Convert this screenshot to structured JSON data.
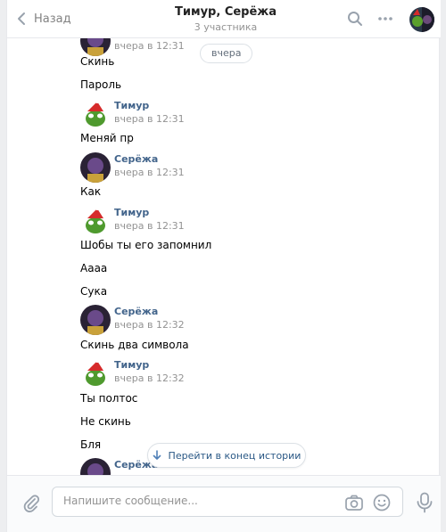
{
  "header": {
    "back_label": "Назад",
    "title": "Тимур, Серёжа",
    "subtitle": "3 участника"
  },
  "history": {
    "date_pill": "вчера",
    "messages": [
      {
        "author": "",
        "time": "вчера в 12:31"
      },
      {
        "text": "Скинь"
      },
      {
        "text": "Пароль"
      },
      {
        "author": "Тимур",
        "time": "вчера в 12:31"
      },
      {
        "text": "Меняй пр"
      },
      {
        "author": "Серёжа",
        "time": "вчера в 12:31"
      },
      {
        "text": "Как"
      },
      {
        "author": "Тимур",
        "time": "вчера в 12:31"
      },
      {
        "text": "Шобы ты его запомнил"
      },
      {
        "text": "Аааа"
      },
      {
        "text": "Сука"
      },
      {
        "author": "Серёжа",
        "time": "вчера в 12:32"
      },
      {
        "text": "Скинь два символа"
      },
      {
        "author": "Тимур",
        "time": "вчера в 12:32"
      },
      {
        "text": "Ты полтос"
      },
      {
        "text": "Не скинь"
      },
      {
        "text": "Бля"
      },
      {
        "author": "Серёжа",
        "time": ""
      }
    ],
    "scroll_button_label": "Перейти в конец истории"
  },
  "composer": {
    "placeholder": "Напишите сообщение..."
  },
  "colors": {
    "author_name": "#42648b",
    "link": "#2a5885",
    "muted": "#939393"
  },
  "icons": [
    "back-arrow-icon",
    "search-icon",
    "more-icon",
    "chat-avatar",
    "arrow-down-icon",
    "attach-icon",
    "camera-icon",
    "smile-icon",
    "mic-icon"
  ]
}
